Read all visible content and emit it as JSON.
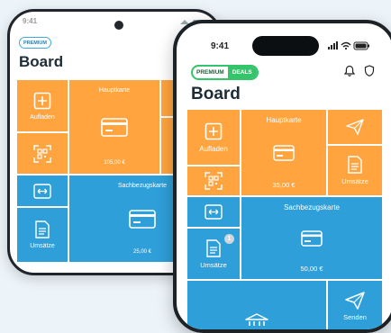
{
  "back_phone": {
    "badge": "PREMIUM",
    "title": "Board",
    "tiles": {
      "aufladen": "Aufladen",
      "hauptkarte": "Hauptkarte",
      "hauptkarte_amount": "105,00 €",
      "sachbezugskarte": "Sachbezugskarte",
      "sachbezugskarte_amount": "25,00 €",
      "umsaetze": "Umsätze"
    }
  },
  "front_phone": {
    "time": "9:41",
    "badge_premium": "PREMIUM",
    "badge_deals": "DEALS",
    "title": "Board",
    "tiles": {
      "aufladen": "Aufladen",
      "hauptkarte": "Hauptkarte",
      "hauptkarte_amount": "35,00 €",
      "umsaetze_top": "Umsätze",
      "sachbezugskarte": "Sachbezugskarte",
      "sachbezugskarte_amount": "50,00 €",
      "umsaetze": "Umsätze",
      "umsaetze_badge": "1",
      "senden_partial": "Senden"
    }
  },
  "colors": {
    "orange": "#ffa43f",
    "blue": "#2e9fd8",
    "green": "#34c46a",
    "background": "#ecf4f9"
  },
  "icons": [
    "plus-square-icon",
    "qr-scan-icon",
    "card-icon",
    "transfer-arrows-icon",
    "document-icon",
    "paper-plane-icon",
    "bell-icon",
    "shield-icon",
    "signal-icon",
    "wifi-icon",
    "battery-icon",
    "bank-icon"
  ]
}
